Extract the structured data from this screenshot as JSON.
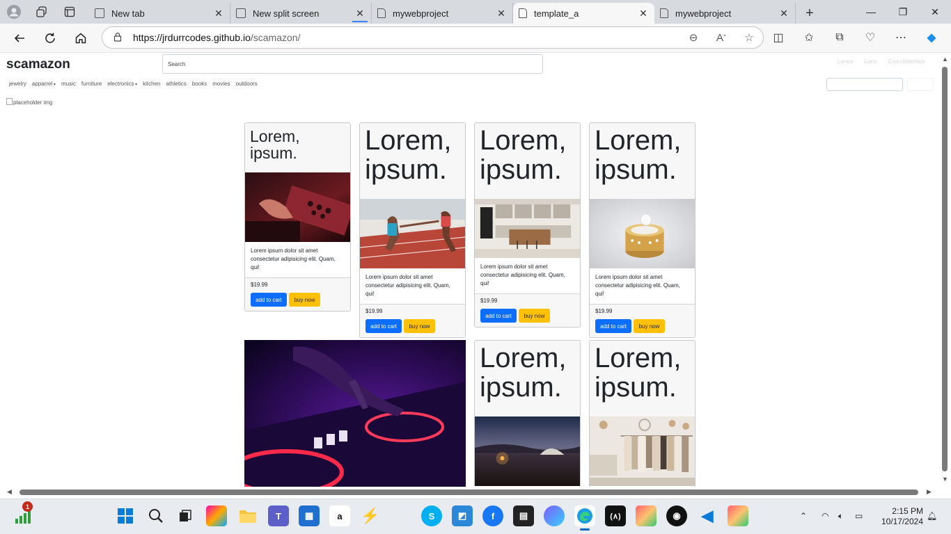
{
  "browser": {
    "tabs": [
      {
        "title": "New tab",
        "active": false
      },
      {
        "title": "New split screen",
        "active": false
      },
      {
        "title": "mywebproject",
        "active": false
      },
      {
        "title": "template_a",
        "active": true
      },
      {
        "title": "mywebproject",
        "active": false
      }
    ],
    "url_domain": "https://jrdurrcodes.github.io",
    "url_path": "/scamazon/"
  },
  "site": {
    "logo": "scamazon",
    "search_placeholder": "Search",
    "top_links": [
      "Lorem",
      "Lorm",
      "Exercitationem"
    ],
    "categories": [
      {
        "label": "jewelry",
        "dropdown": false
      },
      {
        "label": "apparrel",
        "dropdown": true
      },
      {
        "label": "music",
        "dropdown": false
      },
      {
        "label": "furniture",
        "dropdown": false
      },
      {
        "label": "electronics",
        "dropdown": true
      },
      {
        "label": "kitchen",
        "dropdown": false
      },
      {
        "label": "athletics",
        "dropdown": false
      },
      {
        "label": "books",
        "dropdown": false
      },
      {
        "label": "movies",
        "dropdown": false
      },
      {
        "label": "outdoors",
        "dropdown": false
      }
    ],
    "placeholder_alt": "placeholder img",
    "cards": [
      {
        "title": "Lorem, ipsum.",
        "image": "synthesizer keyboard",
        "text": "Lorem ipsum dolor sit amet consectetur adipisicing elit. Quam, qui!",
        "price": "$19.99",
        "add_label": "add to cart",
        "buy_label": "buy now"
      },
      {
        "title": "Lorem, ipsum.",
        "image": "relay runners on track",
        "text": "Lorem ipsum dolor sit amet consectetur adipisicing elit. Quam, qui!",
        "price": "$19.99",
        "add_label": "add to cart",
        "buy_label": "buy now"
      },
      {
        "title": "Lorem, ipsum.",
        "image": "modern kitchen",
        "text": "Lorem ipsum dolor sit amet consectetur adipisicing elit. Quam, qui!",
        "price": "$19.99",
        "add_label": "add to cart",
        "buy_label": "buy now"
      },
      {
        "title": "Lorem, ipsum.",
        "image": "gold rings",
        "text": "Lorem ipsum dolor sit amet consectetur adipisicing elit. Quam, qui!",
        "price": "$19.99",
        "add_label": "add to cart",
        "buy_label": "buy now"
      },
      {
        "title": "Lorem, ipsum.",
        "image": "camping tent at night"
      },
      {
        "title": "Lorem, ipsum.",
        "image": "clothing rack boutique"
      }
    ],
    "hero_image": "DJ mixer purple lights"
  },
  "taskbar": {
    "badge": "1",
    "time": "2:15 PM",
    "date": "10/17/2024"
  }
}
